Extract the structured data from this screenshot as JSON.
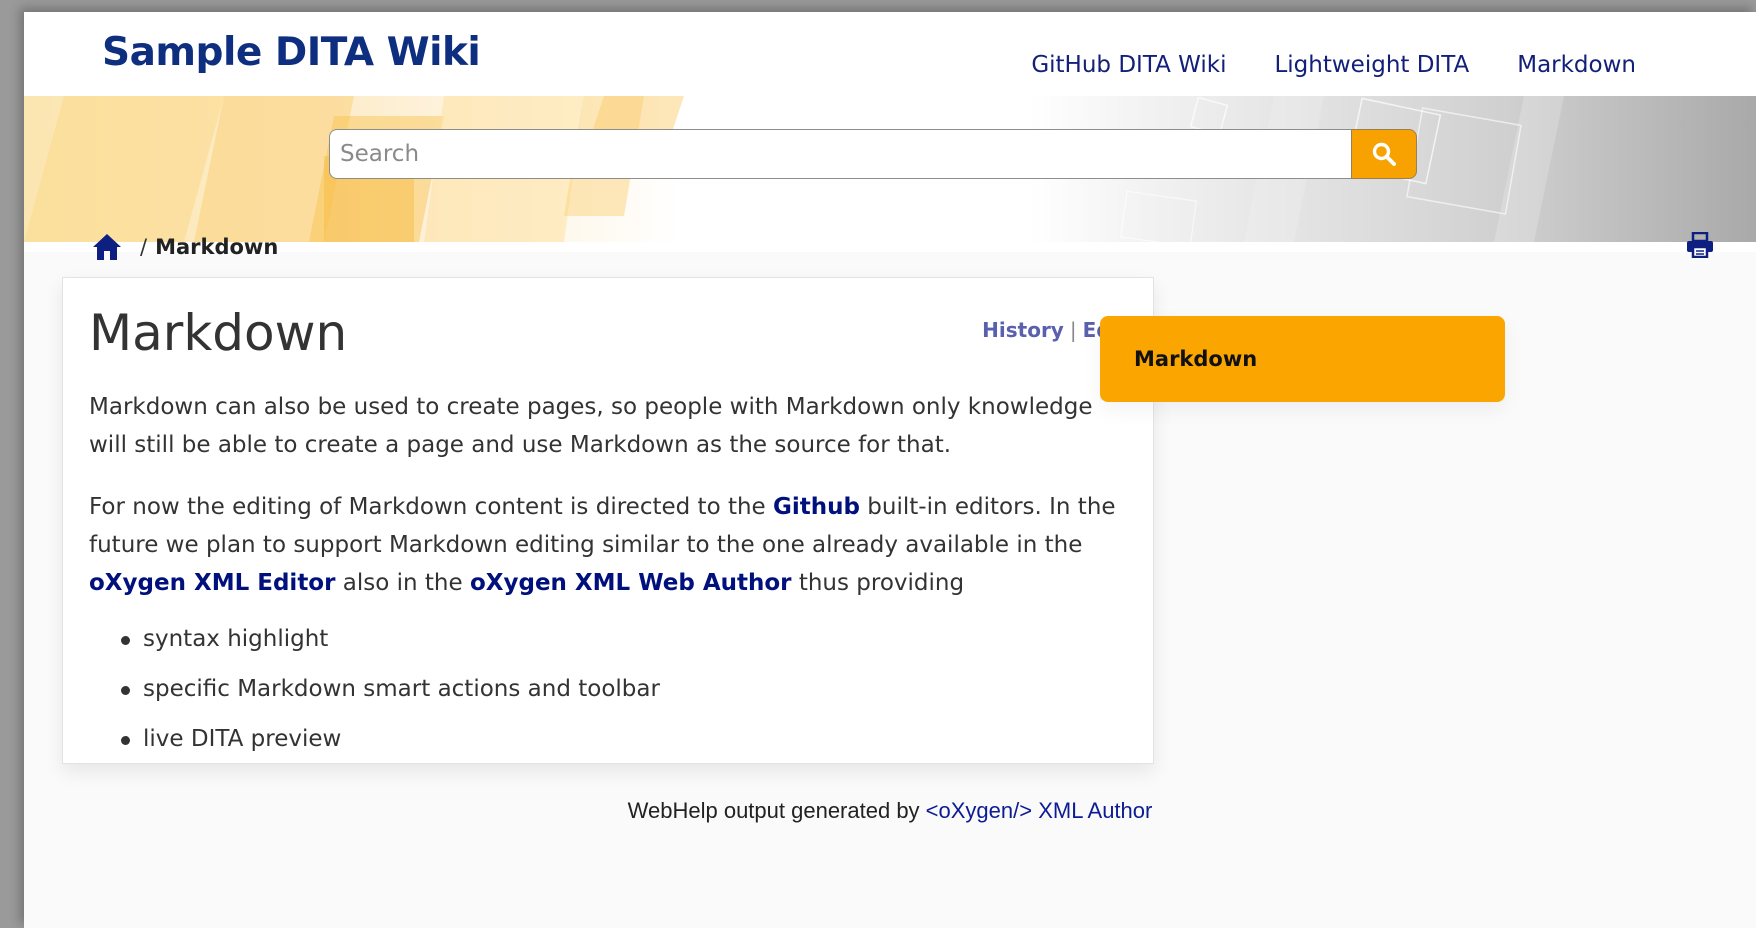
{
  "header": {
    "site_title": "Sample DITA Wiki",
    "nav": [
      {
        "label": "GitHub DITA Wiki"
      },
      {
        "label": "Lightweight DITA"
      },
      {
        "label": "Markdown"
      }
    ]
  },
  "search": {
    "placeholder": "Search",
    "button_icon": "search-icon"
  },
  "breadcrumb": {
    "home_icon": "home-icon",
    "separator": "/",
    "current": "Markdown"
  },
  "print_icon": "printer-icon",
  "article": {
    "title": "Markdown",
    "history_label": "History",
    "divider": "|",
    "edit_label": "Edit",
    "para1": "Markdown can also be used to create pages, so people with Markdown only knowledge will still be able to create a page and use Markdown as the source for that.",
    "para2": {
      "t1": "For now the editing of Markdown content is directed to the ",
      "link1": "Github",
      "t2": " built-in editors. In the future we plan to support Markdown editing similar to the one already available in the ",
      "link2": "oXygen XML Editor",
      "t3": " also in the ",
      "link3": "oXygen XML Web Author",
      "t4": " thus providing"
    },
    "bullets": [
      "syntax highlight",
      "specific Markdown smart actions and toolbar",
      "live DITA preview"
    ]
  },
  "toc": {
    "active_item": "Markdown"
  },
  "footer": {
    "text": "WebHelp output generated by ",
    "link": "<oXygen/> XML Author"
  },
  "colors": {
    "title_blue": "#0e2e80",
    "nav_blue": "#122079",
    "accent_orange": "#f7a200",
    "link_purple": "#5a5fae"
  }
}
